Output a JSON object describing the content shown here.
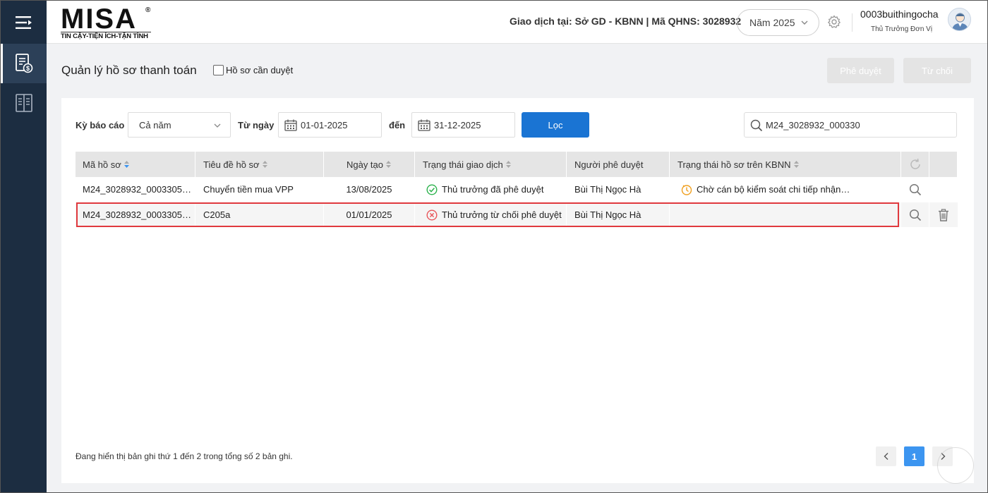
{
  "brand": {
    "name": "MISA",
    "registered_mark": "®",
    "tagline": "TIN CẬY-TIỆN ÍCH-TẬN TÌNH"
  },
  "header": {
    "transaction_info": "Giao dịch tại: Sở GD - KBNN | Mã QHNS: 3028932",
    "year_select": "Năm 2025",
    "user_name": "0003buithingocha",
    "user_role": "Thủ Trưởng Đơn Vị"
  },
  "page": {
    "title": "Quản lý hồ sơ thanh toán",
    "pending_checkbox_label": "Hồ sơ cần duyệt",
    "approve_button": "Phê duyệt",
    "reject_button": "Từ chối"
  },
  "filters": {
    "period_label": "Kỳ báo cáo",
    "period_value": "Cả năm",
    "from_label": "Từ ngày",
    "from_value": "01-01-2025",
    "to_label": "đến",
    "to_value": "31-12-2025",
    "filter_button": "Lọc",
    "search_value": "M24_3028932_000330"
  },
  "table": {
    "columns": [
      "Mã hồ sơ",
      "Tiêu đề hồ sơ",
      "Ngày tạo",
      "Trạng thái giao dịch",
      "Người phê duyệt",
      "Trạng thái hồ sơ trên KBNN"
    ],
    "rows": [
      {
        "code": "M24_3028932_0003305…",
        "title": "Chuyển tiền mua VPP",
        "created": "13/08/2025",
        "tx_status": "Thủ trưởng đã phê duyệt",
        "approver": "Bùi Thị Ngọc Hà",
        "kbnn_status": "Chờ cán bộ kiểm soát chi tiếp nhận…"
      },
      {
        "code": "M24_3028932_0003305…",
        "title": "C205a",
        "created": "01/01/2025",
        "tx_status": "Thủ trưởng từ chối phê duyệt",
        "approver": "Bùi Thị Ngọc Hà",
        "kbnn_status": ""
      }
    ]
  },
  "footer": {
    "record_info": "Đang hiển thị bản ghi thứ 1 đến 2 trong tổng số 2 bản ghi.",
    "current_page": "1"
  },
  "colors": {
    "sidebar": "#1c2d41",
    "primary": "#1a74d3",
    "approved": "#2bb24c",
    "rejected": "#e8555a",
    "pending": "#f0a020",
    "highlight": "#e0393e"
  }
}
